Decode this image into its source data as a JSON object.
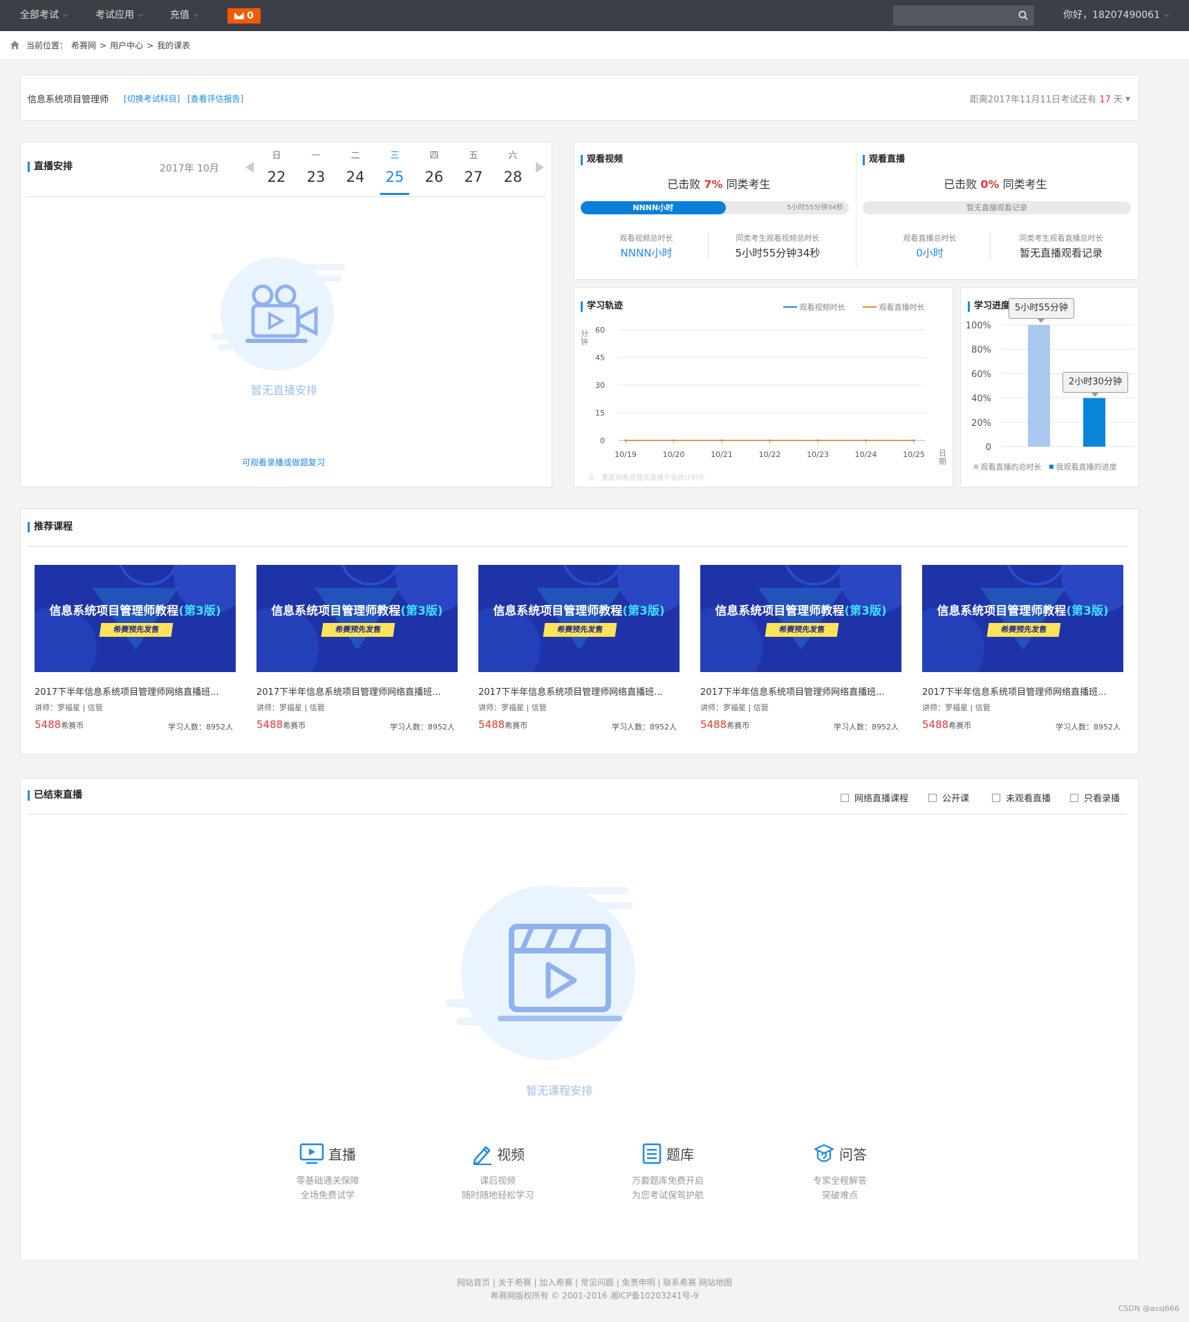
{
  "topnav": {
    "items": [
      "全部考试",
      "考试应用",
      "充值"
    ],
    "mail_count": "0",
    "search_placeholder": "",
    "greeting": "你好，18207490061"
  },
  "breadcrumb": {
    "label": "当前位置：",
    "items": [
      "希赛网",
      "用户中心",
      "我的课表"
    ],
    "sep": ">"
  },
  "exam_header": {
    "subject": "信息系统项目管理师",
    "switch_link": "[切换考试科目]",
    "report_link": "[查看评估报告]",
    "countdown_prefix": "距离2017年11月11日考试还有",
    "countdown_days": "17",
    "countdown_suffix": "天"
  },
  "live_schedule": {
    "title": "直播安排",
    "month": "2017年 10月",
    "days": [
      {
        "weekday": "日",
        "date": "22"
      },
      {
        "weekday": "一",
        "date": "23"
      },
      {
        "weekday": "二",
        "date": "24"
      },
      {
        "weekday": "三",
        "date": "25"
      },
      {
        "weekday": "四",
        "date": "26"
      },
      {
        "weekday": "五",
        "date": "27"
      },
      {
        "weekday": "六",
        "date": "28"
      }
    ],
    "active_index": 3,
    "empty_text": "暂无直播安排",
    "replay_link": "可观看录播或做题复习"
  },
  "watch_video": {
    "title": "观看视频",
    "beat_prefix": "已击败",
    "beat_pct": "7%",
    "beat_suffix": "同类考生",
    "bar_label": "NNNN小时",
    "bar_right": "5小时55分钟34秒",
    "bar_fill": 0.54,
    "stat1_label": "观看视频总时长",
    "stat1_value": "NNNN小时",
    "stat2_label": "同类考生观看视频总时长",
    "stat2_value": "5小时55分钟34秒"
  },
  "watch_live": {
    "title": "观看直播",
    "beat_prefix": "已击败",
    "beat_pct": "0%",
    "beat_suffix": "同类考生",
    "bar_label": "暂无直播观看记录",
    "stat1_label": "观看直播总时长",
    "stat1_value": "0小时",
    "stat2_label": "同类考生观看直播总时长",
    "stat2_value": "暂无直播观看记录"
  },
  "study_track": {
    "title": "学习轨迹",
    "legend": [
      "观看视频时长",
      "观看直播时长"
    ],
    "y_unit": "分钟",
    "x_unit": "日期",
    "note": "注：重复观看直播或录播不会统计时长"
  },
  "study_progress": {
    "title": "学习进度",
    "tooltip1": "5小时55分钟",
    "tooltip2": "2小时30分钟",
    "legend": [
      "观看直播的总时长",
      "我观看直播的进度"
    ]
  },
  "chart_data": [
    {
      "type": "line",
      "x": [
        "10/19",
        "10/20",
        "10/21",
        "10/22",
        "10/23",
        "10/24",
        "10/25"
      ],
      "series": [
        {
          "name": "观看视频时长",
          "values": [
            0,
            0,
            0,
            0,
            0,
            0,
            0
          ],
          "color": "#1e88e5"
        },
        {
          "name": "观看直播时长",
          "values": [
            0,
            0,
            0,
            0,
            0,
            0,
            0
          ],
          "color": "#f08a24"
        }
      ],
      "yticks": [
        0,
        15,
        30,
        45,
        60
      ],
      "ylim": [
        0,
        60
      ],
      "ylabel": "分钟",
      "xlabel": "日期",
      "grid": true,
      "legend": "top-right"
    },
    {
      "type": "bar",
      "categories": [
        "观看直播的总时长",
        "我观看直播的进度"
      ],
      "values": [
        100,
        40
      ],
      "colors": [
        "#a8c8f0",
        "#0a86d8"
      ],
      "yticks": [
        "0",
        "20%",
        "40%",
        "60%",
        "80%",
        "100%"
      ],
      "ylim": [
        0,
        100
      ],
      "legend": "bottom"
    }
  ],
  "recommended": {
    "title": "推荐课程",
    "courses": [
      {
        "img_title": "信息系统项目管理师教程",
        "img_hl": "(第3版)",
        "img_ribbon": "希赛预先发售",
        "name": "2017下半年信息系统项目管理师网络直播班...",
        "teacher": "讲师：罗福星 | 信管",
        "price": "5488",
        "price_unit": "希赛币",
        "count": "学习人数：8952人"
      },
      {
        "img_title": "信息系统项目管理师教程",
        "img_hl": "(第3版)",
        "img_ribbon": "希赛预先发售",
        "name": "2017下半年信息系统项目管理师网络直播班...",
        "teacher": "讲师：罗福星 | 信管",
        "price": "5488",
        "price_unit": "希赛币",
        "count": "学习人数：8952人"
      },
      {
        "img_title": "信息系统项目管理师教程",
        "img_hl": "(第3版)",
        "img_ribbon": "希赛预先发售",
        "name": "2017下半年信息系统项目管理师网络直播班...",
        "teacher": "讲师：罗福星 | 信管",
        "price": "5488",
        "price_unit": "希赛币",
        "count": "学习人数：8952人"
      },
      {
        "img_title": "信息系统项目管理师教程",
        "img_hl": "(第3版)",
        "img_ribbon": "希赛预先发售",
        "name": "2017下半年信息系统项目管理师网络直播班...",
        "teacher": "讲师：罗福星 | 信管",
        "price": "5488",
        "price_unit": "希赛币",
        "count": "学习人数：8952人"
      },
      {
        "img_title": "信息系统项目管理师教程",
        "img_hl": "(第3版)",
        "img_ribbon": "希赛预先发售",
        "name": "2017下半年信息系统项目管理师网络直播班...",
        "teacher": "讲师：罗福星 | 信管",
        "price": "5488",
        "price_unit": "希赛币",
        "count": "学习人数：8952人"
      }
    ]
  },
  "ended_live": {
    "title": "已结束直播",
    "filters": [
      "网络直播课程",
      "公开课",
      "未观看直播",
      "只看录播"
    ],
    "empty_text": "暂无课程安排",
    "features": [
      {
        "icon": "tv-play-icon",
        "title": "直播",
        "line1": "零基础通关保障",
        "line2": "全场免费试学"
      },
      {
        "icon": "pencil-icon",
        "title": "视频",
        "line1": "课后视频",
        "line2": "随时随地轻松学习"
      },
      {
        "icon": "book-icon",
        "title": "题库",
        "line1": "万套题库免费开启",
        "line2": "为您考试保驾护航"
      },
      {
        "icon": "question-icon",
        "title": "问答",
        "line1": "专家全程解答",
        "line2": "突破难点"
      }
    ]
  },
  "footer": {
    "links": [
      "网站首页",
      "关于希赛",
      "加入希赛",
      "常见问题",
      "免责申明",
      "联系希赛",
      "网站地图"
    ],
    "copyright": "希赛网版权所有 © 2001-2016 湘ICP备10203241号-9"
  },
  "watermark": "CSDN @assj666",
  "colors": {
    "accent": "#1e88e5",
    "topbar": "#3d3f46",
    "badge": "#f55a00",
    "highlight_red": "#e03a3a"
  }
}
